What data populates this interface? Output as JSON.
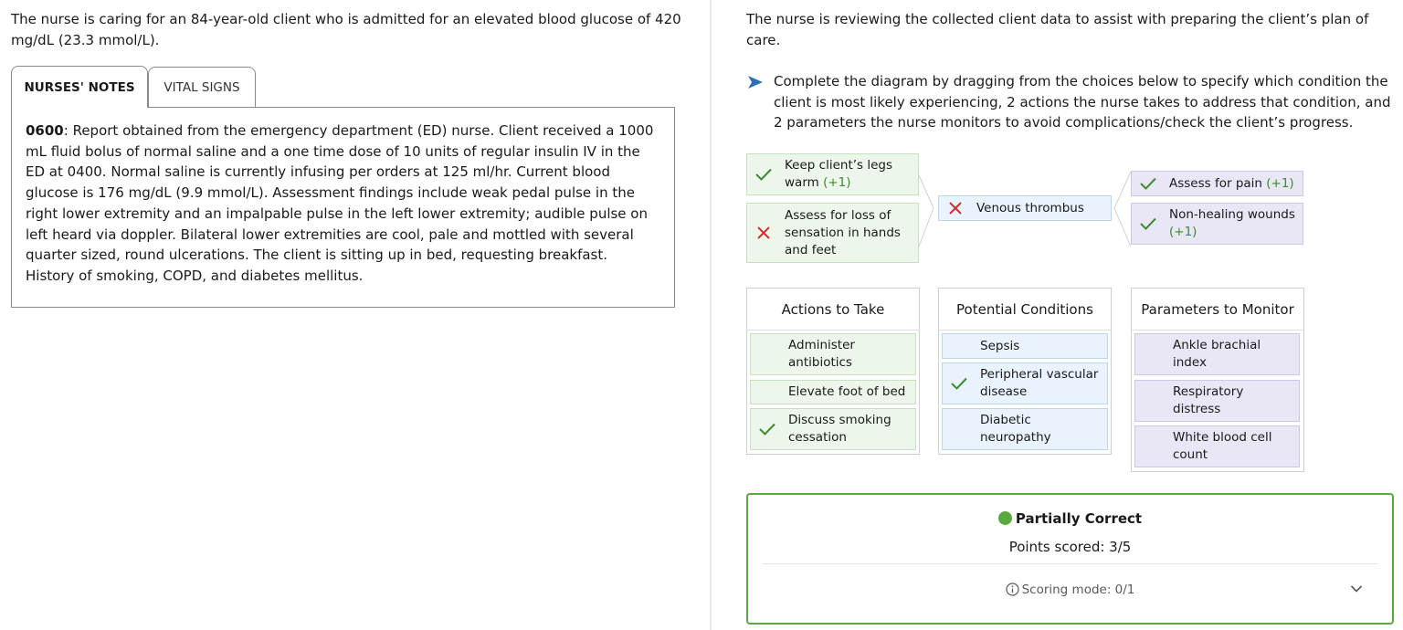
{
  "left": {
    "stem": "The nurse is caring for an 84-year-old client who is admitted for an elevated blood glucose of 420 mg/dL (23.3 mmol/L).",
    "tabs": [
      "NURSES' NOTES",
      "VITAL SIGNS"
    ],
    "notes_time": "0600",
    "notes_text": ": Report obtained from the emergency department (ED) nurse. Client received a 1000 mL fluid bolus of normal saline and a one time dose of 10 units of regular insulin IV in the ED at 0400. Normal saline is currently infusing per orders at 125 ml/hr. Current blood glucose is 176 mg/dL (9.9 mmol/L). Assessment findings include weak pedal pulse in the right lower extremity and an impalpable pulse in the left lower extremity; audible pulse on left heard via doppler. Bilateral lower extremities are cool, pale and mottled with several quarter sized, round ulcerations. The client is sitting up in bed, requesting breakfast. History of smoking, COPD, and diabetes mellitus."
  },
  "right": {
    "stem": "The nurse is reviewing the collected client data to assist with preparing the client’s plan of care.",
    "instruction": "Complete the diagram by dragging from the choices below to specify which condition the client is most likely experiencing, 2 actions the nurse takes to address that condition, and 2 parameters the nurse monitors to avoid complications/check the client’s progress.",
    "diagram": {
      "actions": [
        {
          "text": "Keep client’s legs warm",
          "bonus": "(+1)",
          "status": "correct"
        },
        {
          "text": "Assess for loss of sensation in hands and feet",
          "bonus": "",
          "status": "incorrect"
        }
      ],
      "condition": {
        "text": "Venous thrombus",
        "status": "incorrect"
      },
      "parameters": [
        {
          "text": "Assess for pain",
          "bonus": "(+1)",
          "status": "correct"
        },
        {
          "text": "Non-healing wounds",
          "bonus": "(+1)",
          "status": "correct"
        }
      ]
    },
    "columns": {
      "actions_title": "Actions to Take",
      "conditions_title": "Potential Conditions",
      "parameters_title": "Parameters to Monitor",
      "actions": [
        "Administer antibiotics",
        "Elevate foot of bed",
        "Discuss smoking cessation"
      ],
      "conditions": [
        "Sepsis",
        "Peripheral vascular disease",
        "Diabetic neuropathy"
      ],
      "parameters": [
        "Ankle brachial index",
        "Respiratory distress",
        "White blood cell count"
      ]
    },
    "result": {
      "title": "Partially Correct",
      "points": "Points scored: 3/5",
      "mode": "Scoring mode: 0/1"
    }
  },
  "colors": {
    "correct": "#3f8a2e",
    "incorrect": "#d32f2f",
    "green_bg": "#edf6ea",
    "blue_bg": "#e8f3fd",
    "purple_bg": "#e9e6f6",
    "result_border": "#5aa93f"
  },
  "icons": {
    "instruction": "play-arrow-icon",
    "correct": "check-icon",
    "incorrect": "x-icon",
    "info": "info-icon",
    "expand": "chevron-down-icon"
  }
}
